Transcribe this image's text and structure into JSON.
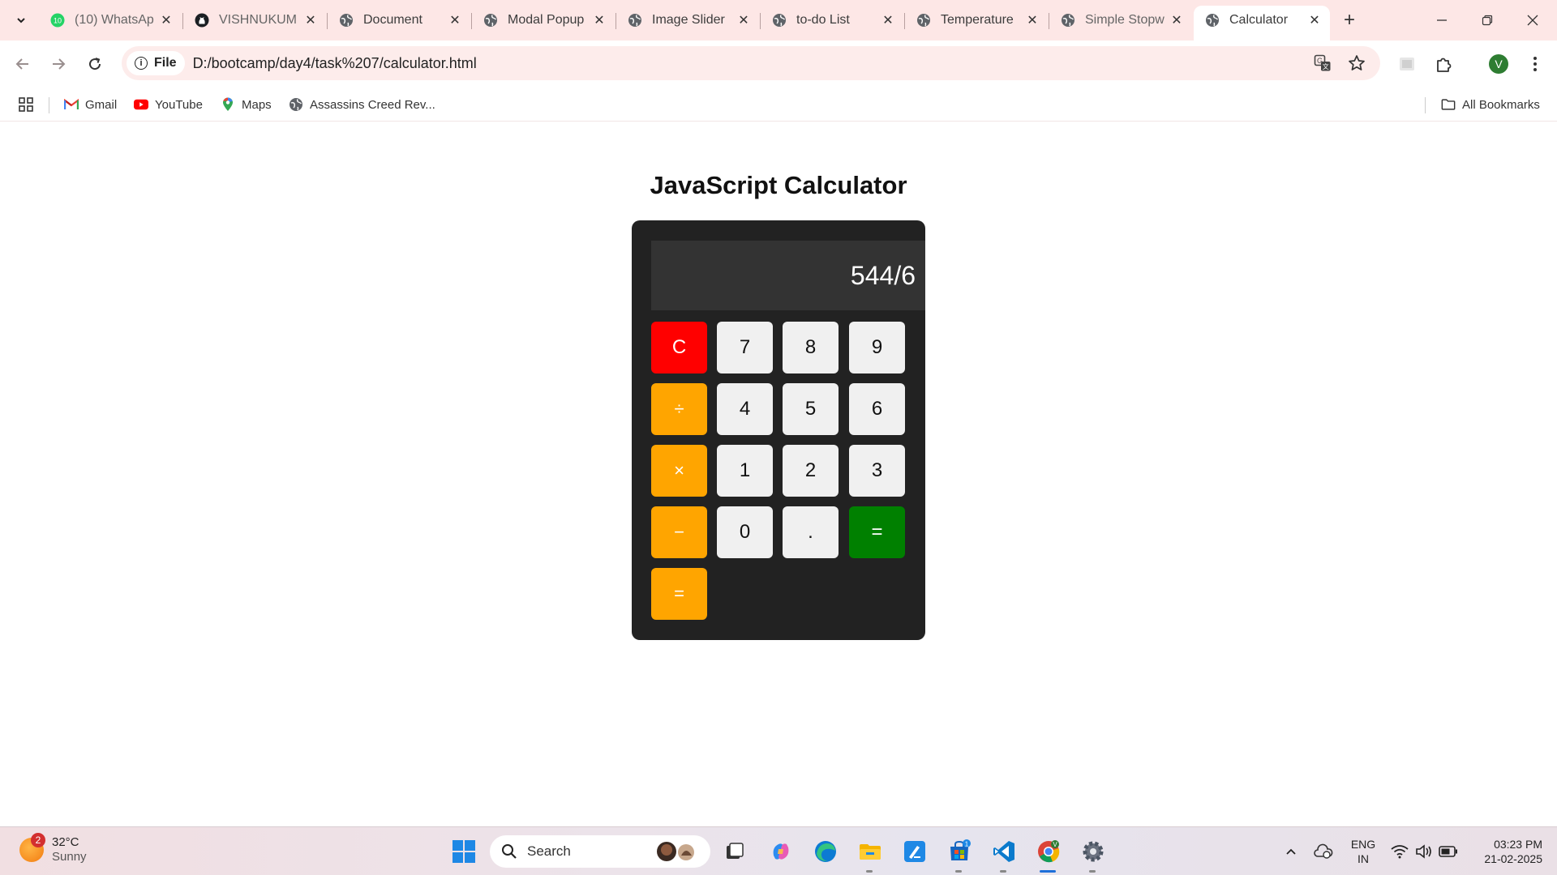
{
  "browser": {
    "tabs": [
      {
        "title": "(10) WhatsAp",
        "icon": "whatsapp-icon",
        "active": false
      },
      {
        "title": "VISHNUKUM",
        "icon": "github-icon",
        "active": false
      },
      {
        "title": "Document",
        "icon": "globe-icon",
        "active": false
      },
      {
        "title": "Modal Popup",
        "icon": "globe-icon",
        "active": false
      },
      {
        "title": "Image Slider",
        "icon": "globe-icon",
        "active": false
      },
      {
        "title": "to-do List",
        "icon": "globe-icon",
        "active": false
      },
      {
        "title": "Temperature",
        "icon": "globe-icon",
        "active": false
      },
      {
        "title": "Simple Stopw",
        "icon": "globe-icon",
        "active": false
      },
      {
        "title": "Calculator",
        "icon": "globe-icon",
        "active": true
      }
    ],
    "whatsapp_badge": "10",
    "address": {
      "scheme_chip": "File",
      "url": "D:/bootcamp/day4/task%207/calculator.html"
    },
    "profile_initial": "V",
    "bookmarks": [
      {
        "label": "Gmail",
        "icon": "gmail-icon"
      },
      {
        "label": "YouTube",
        "icon": "youtube-icon"
      },
      {
        "label": "Maps",
        "icon": "maps-icon"
      },
      {
        "label": "Assassins Creed Rev...",
        "icon": "globe-icon"
      }
    ],
    "all_bookmarks": "All Bookmarks"
  },
  "page": {
    "heading": "JavaScript Calculator",
    "display": "544/6",
    "keys": [
      "C",
      "7",
      "8",
      "9",
      "÷",
      "4",
      "5",
      "6",
      "×",
      "1",
      "2",
      "3",
      "−",
      "0",
      ".",
      "=",
      "="
    ]
  },
  "taskbar": {
    "weather_temp": "32°C",
    "weather_desc": "Sunny",
    "weather_badge": "2",
    "search_placeholder": "Search",
    "store_badge": "1",
    "lang_primary": "ENG",
    "lang_secondary": "IN",
    "time": "03:23 PM",
    "date": "21-02-2025"
  },
  "colors": {
    "clear_key": "#ff0000",
    "operator_key": "#ffa500",
    "equals_key": "#008000",
    "calculator_body": "#222222",
    "display_bg": "#333333"
  }
}
